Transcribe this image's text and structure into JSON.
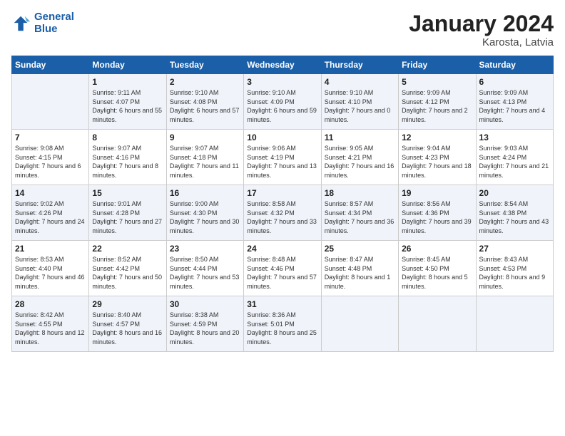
{
  "logo": {
    "line1": "General",
    "line2": "Blue"
  },
  "title": "January 2024",
  "location": "Karosta, Latvia",
  "weekdays": [
    "Sunday",
    "Monday",
    "Tuesday",
    "Wednesday",
    "Thursday",
    "Friday",
    "Saturday"
  ],
  "weeks": [
    [
      {
        "day": "",
        "sunrise": "",
        "sunset": "",
        "daylight": ""
      },
      {
        "day": "1",
        "sunrise": "Sunrise: 9:11 AM",
        "sunset": "Sunset: 4:07 PM",
        "daylight": "Daylight: 6 hours and 55 minutes."
      },
      {
        "day": "2",
        "sunrise": "Sunrise: 9:10 AM",
        "sunset": "Sunset: 4:08 PM",
        "daylight": "Daylight: 6 hours and 57 minutes."
      },
      {
        "day": "3",
        "sunrise": "Sunrise: 9:10 AM",
        "sunset": "Sunset: 4:09 PM",
        "daylight": "Daylight: 6 hours and 59 minutes."
      },
      {
        "day": "4",
        "sunrise": "Sunrise: 9:10 AM",
        "sunset": "Sunset: 4:10 PM",
        "daylight": "Daylight: 7 hours and 0 minutes."
      },
      {
        "day": "5",
        "sunrise": "Sunrise: 9:09 AM",
        "sunset": "Sunset: 4:12 PM",
        "daylight": "Daylight: 7 hours and 2 minutes."
      },
      {
        "day": "6",
        "sunrise": "Sunrise: 9:09 AM",
        "sunset": "Sunset: 4:13 PM",
        "daylight": "Daylight: 7 hours and 4 minutes."
      }
    ],
    [
      {
        "day": "7",
        "sunrise": "Sunrise: 9:08 AM",
        "sunset": "Sunset: 4:15 PM",
        "daylight": "Daylight: 7 hours and 6 minutes."
      },
      {
        "day": "8",
        "sunrise": "Sunrise: 9:07 AM",
        "sunset": "Sunset: 4:16 PM",
        "daylight": "Daylight: 7 hours and 8 minutes."
      },
      {
        "day": "9",
        "sunrise": "Sunrise: 9:07 AM",
        "sunset": "Sunset: 4:18 PM",
        "daylight": "Daylight: 7 hours and 11 minutes."
      },
      {
        "day": "10",
        "sunrise": "Sunrise: 9:06 AM",
        "sunset": "Sunset: 4:19 PM",
        "daylight": "Daylight: 7 hours and 13 minutes."
      },
      {
        "day": "11",
        "sunrise": "Sunrise: 9:05 AM",
        "sunset": "Sunset: 4:21 PM",
        "daylight": "Daylight: 7 hours and 16 minutes."
      },
      {
        "day": "12",
        "sunrise": "Sunrise: 9:04 AM",
        "sunset": "Sunset: 4:23 PM",
        "daylight": "Daylight: 7 hours and 18 minutes."
      },
      {
        "day": "13",
        "sunrise": "Sunrise: 9:03 AM",
        "sunset": "Sunset: 4:24 PM",
        "daylight": "Daylight: 7 hours and 21 minutes."
      }
    ],
    [
      {
        "day": "14",
        "sunrise": "Sunrise: 9:02 AM",
        "sunset": "Sunset: 4:26 PM",
        "daylight": "Daylight: 7 hours and 24 minutes."
      },
      {
        "day": "15",
        "sunrise": "Sunrise: 9:01 AM",
        "sunset": "Sunset: 4:28 PM",
        "daylight": "Daylight: 7 hours and 27 minutes."
      },
      {
        "day": "16",
        "sunrise": "Sunrise: 9:00 AM",
        "sunset": "Sunset: 4:30 PM",
        "daylight": "Daylight: 7 hours and 30 minutes."
      },
      {
        "day": "17",
        "sunrise": "Sunrise: 8:58 AM",
        "sunset": "Sunset: 4:32 PM",
        "daylight": "Daylight: 7 hours and 33 minutes."
      },
      {
        "day": "18",
        "sunrise": "Sunrise: 8:57 AM",
        "sunset": "Sunset: 4:34 PM",
        "daylight": "Daylight: 7 hours and 36 minutes."
      },
      {
        "day": "19",
        "sunrise": "Sunrise: 8:56 AM",
        "sunset": "Sunset: 4:36 PM",
        "daylight": "Daylight: 7 hours and 39 minutes."
      },
      {
        "day": "20",
        "sunrise": "Sunrise: 8:54 AM",
        "sunset": "Sunset: 4:38 PM",
        "daylight": "Daylight: 7 hours and 43 minutes."
      }
    ],
    [
      {
        "day": "21",
        "sunrise": "Sunrise: 8:53 AM",
        "sunset": "Sunset: 4:40 PM",
        "daylight": "Daylight: 7 hours and 46 minutes."
      },
      {
        "day": "22",
        "sunrise": "Sunrise: 8:52 AM",
        "sunset": "Sunset: 4:42 PM",
        "daylight": "Daylight: 7 hours and 50 minutes."
      },
      {
        "day": "23",
        "sunrise": "Sunrise: 8:50 AM",
        "sunset": "Sunset: 4:44 PM",
        "daylight": "Daylight: 7 hours and 53 minutes."
      },
      {
        "day": "24",
        "sunrise": "Sunrise: 8:48 AM",
        "sunset": "Sunset: 4:46 PM",
        "daylight": "Daylight: 7 hours and 57 minutes."
      },
      {
        "day": "25",
        "sunrise": "Sunrise: 8:47 AM",
        "sunset": "Sunset: 4:48 PM",
        "daylight": "Daylight: 8 hours and 1 minute."
      },
      {
        "day": "26",
        "sunrise": "Sunrise: 8:45 AM",
        "sunset": "Sunset: 4:50 PM",
        "daylight": "Daylight: 8 hours and 5 minutes."
      },
      {
        "day": "27",
        "sunrise": "Sunrise: 8:43 AM",
        "sunset": "Sunset: 4:53 PM",
        "daylight": "Daylight: 8 hours and 9 minutes."
      }
    ],
    [
      {
        "day": "28",
        "sunrise": "Sunrise: 8:42 AM",
        "sunset": "Sunset: 4:55 PM",
        "daylight": "Daylight: 8 hours and 12 minutes."
      },
      {
        "day": "29",
        "sunrise": "Sunrise: 8:40 AM",
        "sunset": "Sunset: 4:57 PM",
        "daylight": "Daylight: 8 hours and 16 minutes."
      },
      {
        "day": "30",
        "sunrise": "Sunrise: 8:38 AM",
        "sunset": "Sunset: 4:59 PM",
        "daylight": "Daylight: 8 hours and 20 minutes."
      },
      {
        "day": "31",
        "sunrise": "Sunrise: 8:36 AM",
        "sunset": "Sunset: 5:01 PM",
        "daylight": "Daylight: 8 hours and 25 minutes."
      },
      {
        "day": "",
        "sunrise": "",
        "sunset": "",
        "daylight": ""
      },
      {
        "day": "",
        "sunrise": "",
        "sunset": "",
        "daylight": ""
      },
      {
        "day": "",
        "sunrise": "",
        "sunset": "",
        "daylight": ""
      }
    ]
  ]
}
